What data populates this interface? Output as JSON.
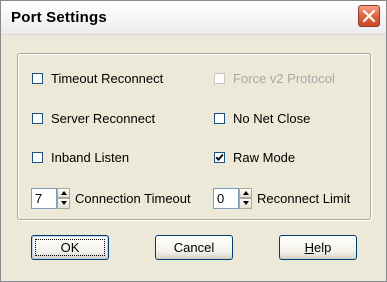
{
  "window": {
    "title": "Port Settings",
    "close_icon": "close-icon"
  },
  "options": {
    "timeout_reconnect": {
      "label": "Timeout Reconnect",
      "checked": false,
      "enabled": true
    },
    "force_v2_protocol": {
      "label": "Force v2 Protocol",
      "checked": false,
      "enabled": false
    },
    "server_reconnect": {
      "label": "Server Reconnect",
      "checked": false,
      "enabled": true
    },
    "no_net_close": {
      "label": "No Net Close",
      "checked": false,
      "enabled": true
    },
    "inband_listen": {
      "label": "Inband Listen",
      "checked": false,
      "enabled": true
    },
    "raw_mode": {
      "label": "Raw Mode",
      "checked": true,
      "enabled": true
    }
  },
  "spinners": {
    "connection_timeout": {
      "value": "7",
      "label": "Connection Timeout"
    },
    "reconnect_limit": {
      "value": "0",
      "label": "Reconnect Limit"
    }
  },
  "buttons": {
    "ok": "OK",
    "cancel": "Cancel",
    "help_first": "H",
    "help_rest": "elp"
  },
  "colors": {
    "dialog_bg": "#ece9d8",
    "close_button": "#e0633f",
    "disabled_text": "#a7a7a7"
  }
}
